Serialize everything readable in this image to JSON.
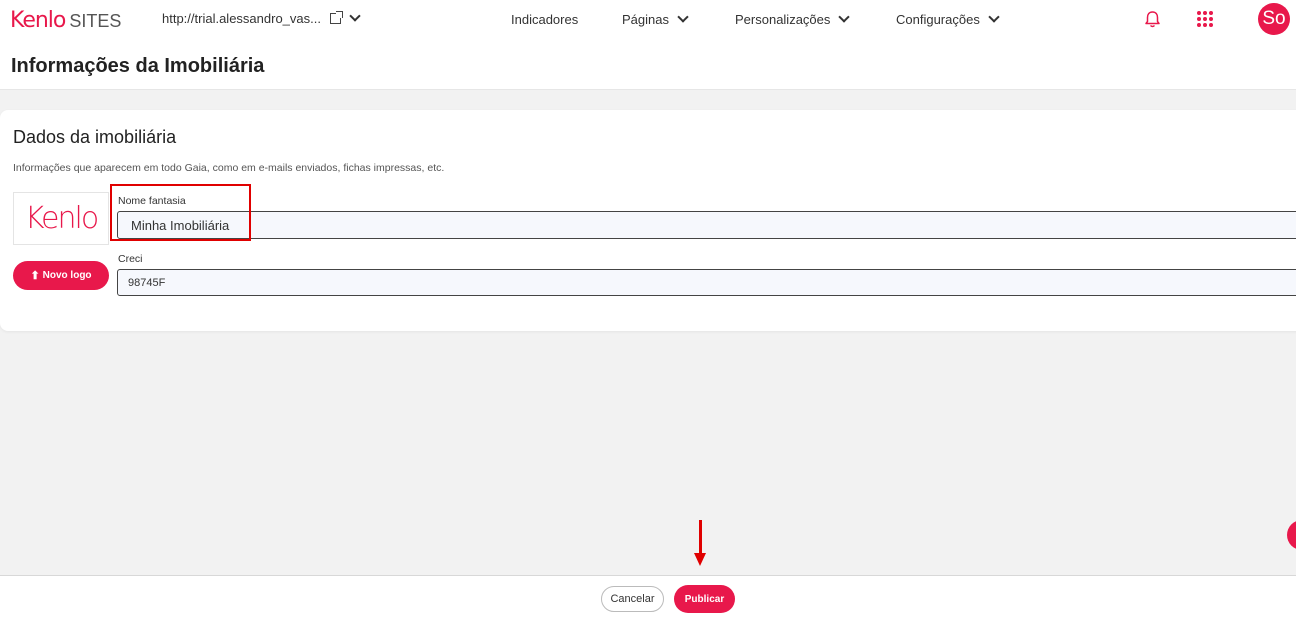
{
  "header": {
    "brand_kenlo": "Kenlo",
    "brand_sites": "SITES",
    "site_url": "http://trial.alessandro_vas...",
    "nav": [
      {
        "label": "Indicadores"
      },
      {
        "label": "Páginas"
      },
      {
        "label": "Personalizações"
      },
      {
        "label": "Configurações"
      }
    ],
    "avatar_initials": "So",
    "icons": [
      "external-link-icon",
      "chevron-down-icon",
      "bell-icon",
      "apps-grid-icon"
    ]
  },
  "page": {
    "title": "Informações da Imobiliária"
  },
  "card": {
    "title": "Dados da imobiliária",
    "subtitle": "Informações que aparecem em todo Gaia, como em e-mails enviados, fichas impressas, etc.",
    "logo_text": "Kenlo",
    "novo_logo_label": "Novo logo",
    "fields": {
      "nome_fantasia": {
        "label": "Nome fantasia",
        "value": "Minha Imobiliária"
      },
      "creci": {
        "label": "Creci",
        "value": "98745F"
      }
    }
  },
  "footer": {
    "cancel_label": "Cancelar",
    "publish_label": "Publicar"
  },
  "colors": {
    "brand": "#e8184b",
    "annotation": "#e00000",
    "background": "#f2f2f2"
  }
}
